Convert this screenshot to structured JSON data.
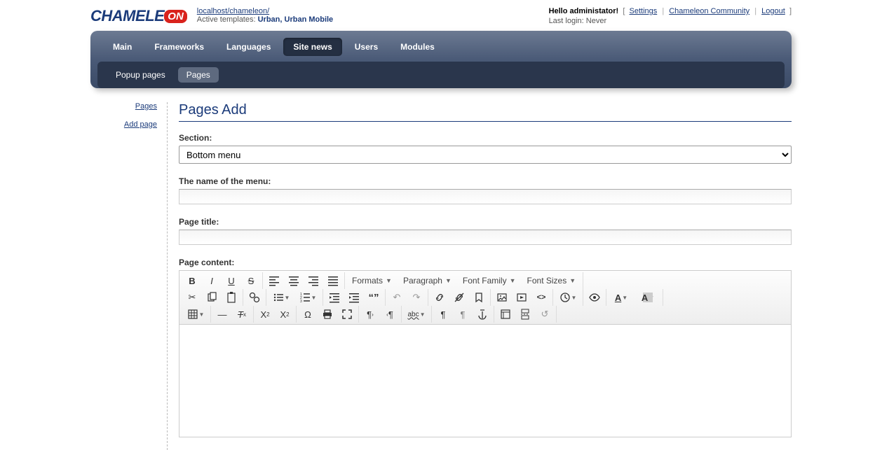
{
  "header": {
    "logo_main": "CHAMELE",
    "logo_badge": "ON",
    "host_url": "localhost/chameleon/",
    "templates_label": "Active templates: ",
    "templates_value": "Urban, Urban Mobile",
    "greeting": "Hello administator!",
    "settings": "Settings",
    "community": "Chameleon Community",
    "logout": "Logout",
    "last_login_label": "Last login: ",
    "last_login_value": "Never"
  },
  "nav": {
    "items": [
      "Main",
      "Frameworks",
      "Languages",
      "Site news",
      "Users",
      "Modules"
    ],
    "sub": [
      "Popup pages",
      "Pages"
    ]
  },
  "sidebar": {
    "pages": "Pages",
    "add": "Add page"
  },
  "form": {
    "title": "Pages Add",
    "section_label": "Section:",
    "section_value": "Bottom menu",
    "menu_name_label": "The name of the menu:",
    "page_title_label": "Page title:",
    "content_label": "Page content:"
  },
  "editor": {
    "formats": "Formats",
    "paragraph": "Paragraph",
    "font_family": "Font Family",
    "font_sizes": "Font Sizes"
  }
}
